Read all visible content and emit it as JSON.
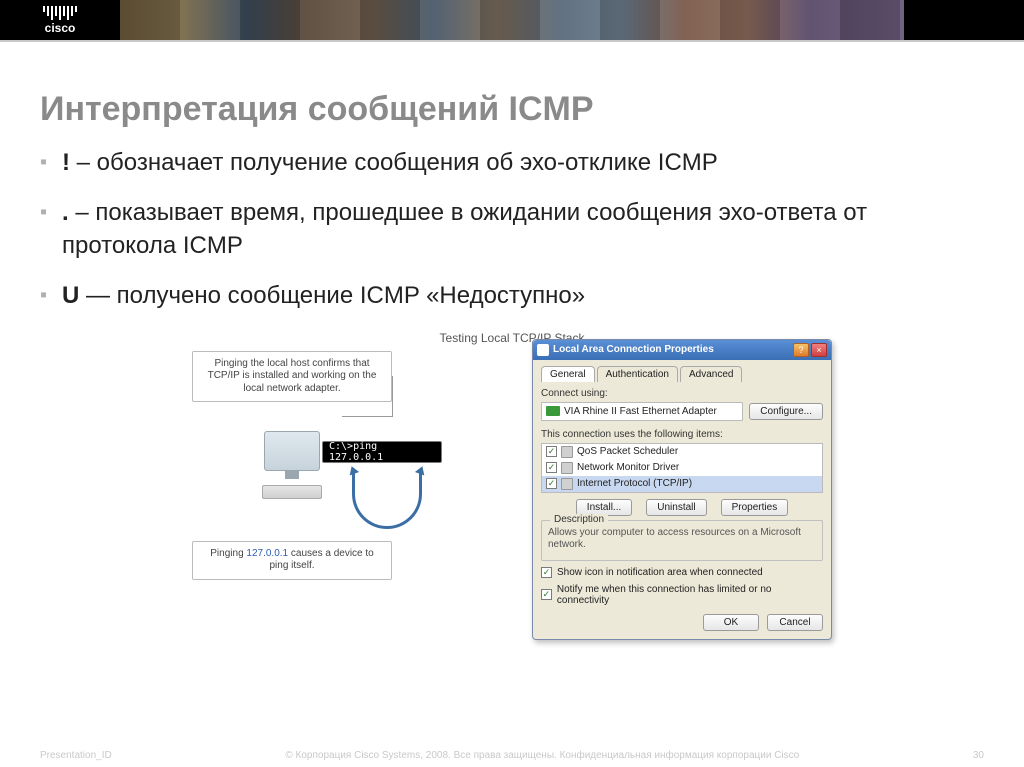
{
  "brand": {
    "name": "cisco"
  },
  "title": "Интерпретация сообщений ICMP",
  "bullets": [
    {
      "sym": "!",
      "text": " – обозначает получение сообщения об эхо-отклике ICMP"
    },
    {
      "sym": ".",
      "text": " – показывает время, прошедшее в ожидании сообщения эхо-ответа от протокола ICMP"
    },
    {
      "sym": "U",
      "text": " — получено сообщение ICMP «Недоступно»"
    }
  ],
  "diagram": {
    "title": "Testing Local TCP/IP Stack",
    "callout_top": "Pinging the local host confirms that TCP/IP is installed and working on the local network adapter.",
    "callout_bottom_pre": "Pinging ",
    "callout_bottom_ip": "127.0.0.1",
    "callout_bottom_post": " causes a device to ping itself.",
    "cmd": "C:\\>ping 127.0.0.1"
  },
  "dialog": {
    "title": "Local Area Connection Properties",
    "tabs": [
      "General",
      "Authentication",
      "Advanced"
    ],
    "connect_label": "Connect using:",
    "adapter": "VIA Rhine II Fast Ethernet Adapter",
    "configure": "Configure...",
    "uses_label": "This connection uses the following items:",
    "items": [
      {
        "chk": true,
        "label": "QoS Packet Scheduler"
      },
      {
        "chk": true,
        "label": "Network Monitor Driver"
      },
      {
        "chk": true,
        "label": "Internet Protocol (TCP/IP)",
        "selected": true
      }
    ],
    "install": "Install...",
    "uninstall": "Uninstall",
    "properties": "Properties",
    "desc_title": "Description",
    "desc_text": "Allows your computer to access resources on a Microsoft network.",
    "chk1": "Show icon in notification area when connected",
    "chk2": "Notify me when this connection has limited or no connectivity",
    "ok": "OK",
    "cancel": "Cancel"
  },
  "footer": {
    "left": "Presentation_ID",
    "center": "© Корпорация Cisco Systems, 2008. Все права защищены. Конфиденциальная информация корпорации Cisco",
    "page": "30"
  }
}
